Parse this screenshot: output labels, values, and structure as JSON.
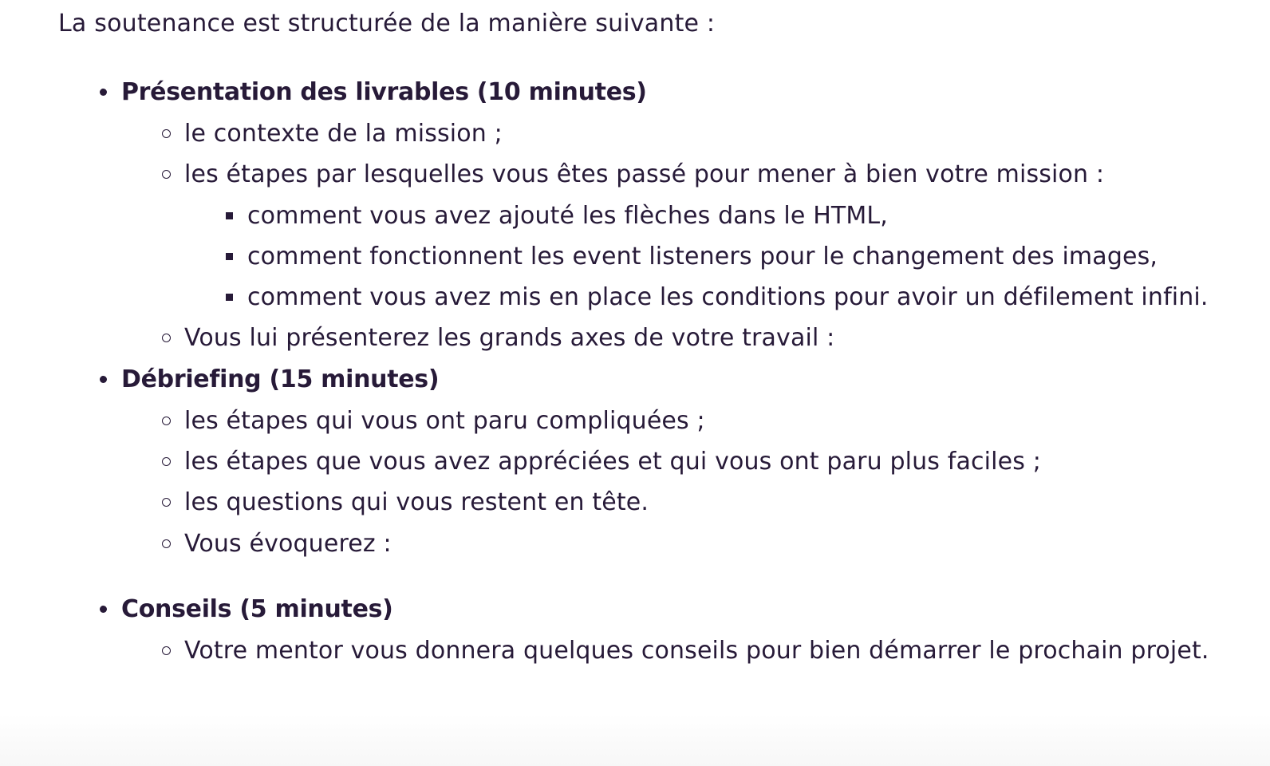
{
  "intro": "La soutenance est structurée de la manière suivante :",
  "sections": [
    {
      "title": "Présentation des livrables (10 minutes)",
      "items": [
        {
          "text": "le contexte de la mission ;"
        },
        {
          "text": "les étapes par lesquelles vous êtes passé pour mener à bien votre mission :",
          "subitems": [
            "comment vous avez ajouté les flèches dans le HTML,",
            "comment fonctionnent les event listeners pour le changement des images,",
            "comment vous avez mis en place les conditions pour avoir un défilement infini."
          ]
        },
        {
          "text": "Vous lui présenterez les grands axes de votre travail :"
        }
      ]
    },
    {
      "title": "Débriefing (15 minutes)",
      "items": [
        {
          "text": "les étapes qui vous ont paru compliquées ;"
        },
        {
          "text": "les étapes que vous avez appréciées et qui vous ont paru plus faciles ;"
        },
        {
          "text": "les questions qui vous restent en tête."
        },
        {
          "text": "Vous évoquerez :"
        }
      ]
    },
    {
      "title": "Conseils (5 minutes)",
      "items": [
        {
          "text": "Votre mentor vous donnera quelques conseils pour bien démarrer le prochain projet."
        }
      ]
    }
  ]
}
